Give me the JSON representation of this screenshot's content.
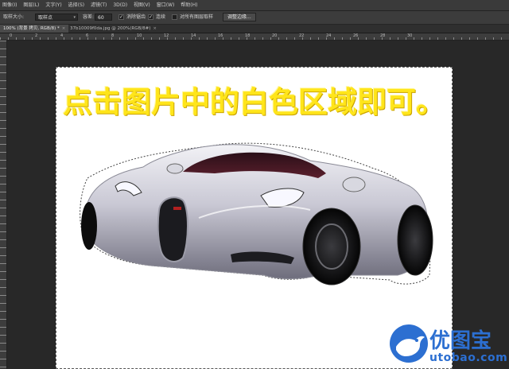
{
  "menubar": {
    "items": [
      "图像(I)",
      "图层(L)",
      "文字(Y)",
      "选择(S)",
      "滤镜(T)",
      "3D(D)",
      "视图(V)",
      "窗口(W)",
      "帮助(H)"
    ]
  },
  "options": {
    "sample_size_label": "取样大小:",
    "sample_size_value": "取样点",
    "tolerance_label": "容差:",
    "tolerance_value": "60",
    "antialias_label": "消除锯齿",
    "antialias_checked": "✓",
    "contiguous_label": "连续",
    "contiguous_checked": "✓",
    "all_layers_label": "对所有图层取样",
    "refine_edge_label": "调整边缘..."
  },
  "tabs": [
    {
      "label": "100% (背景 拷贝, RGB/8) *",
      "close": "×"
    },
    {
      "label": "37b10009f0da.jpg @ 200%(RGB/8#)",
      "close": "×"
    }
  ],
  "ruler": {
    "numbers": [
      "0",
      "2",
      "4",
      "6",
      "8",
      "10",
      "12",
      "14",
      "16",
      "18",
      "20",
      "22",
      "24",
      "26",
      "28",
      "30"
    ]
  },
  "canvas": {
    "overlay_text": "点击图片中的白色区域即可。",
    "image_subject": "sports-car",
    "car_color": "#c9c8d4",
    "text_color": "#ffe51a"
  },
  "watermark": {
    "name": "优图宝",
    "url": "utobao.com",
    "brand_color": "#2c6fd1",
    "icon": "bird-icon"
  }
}
